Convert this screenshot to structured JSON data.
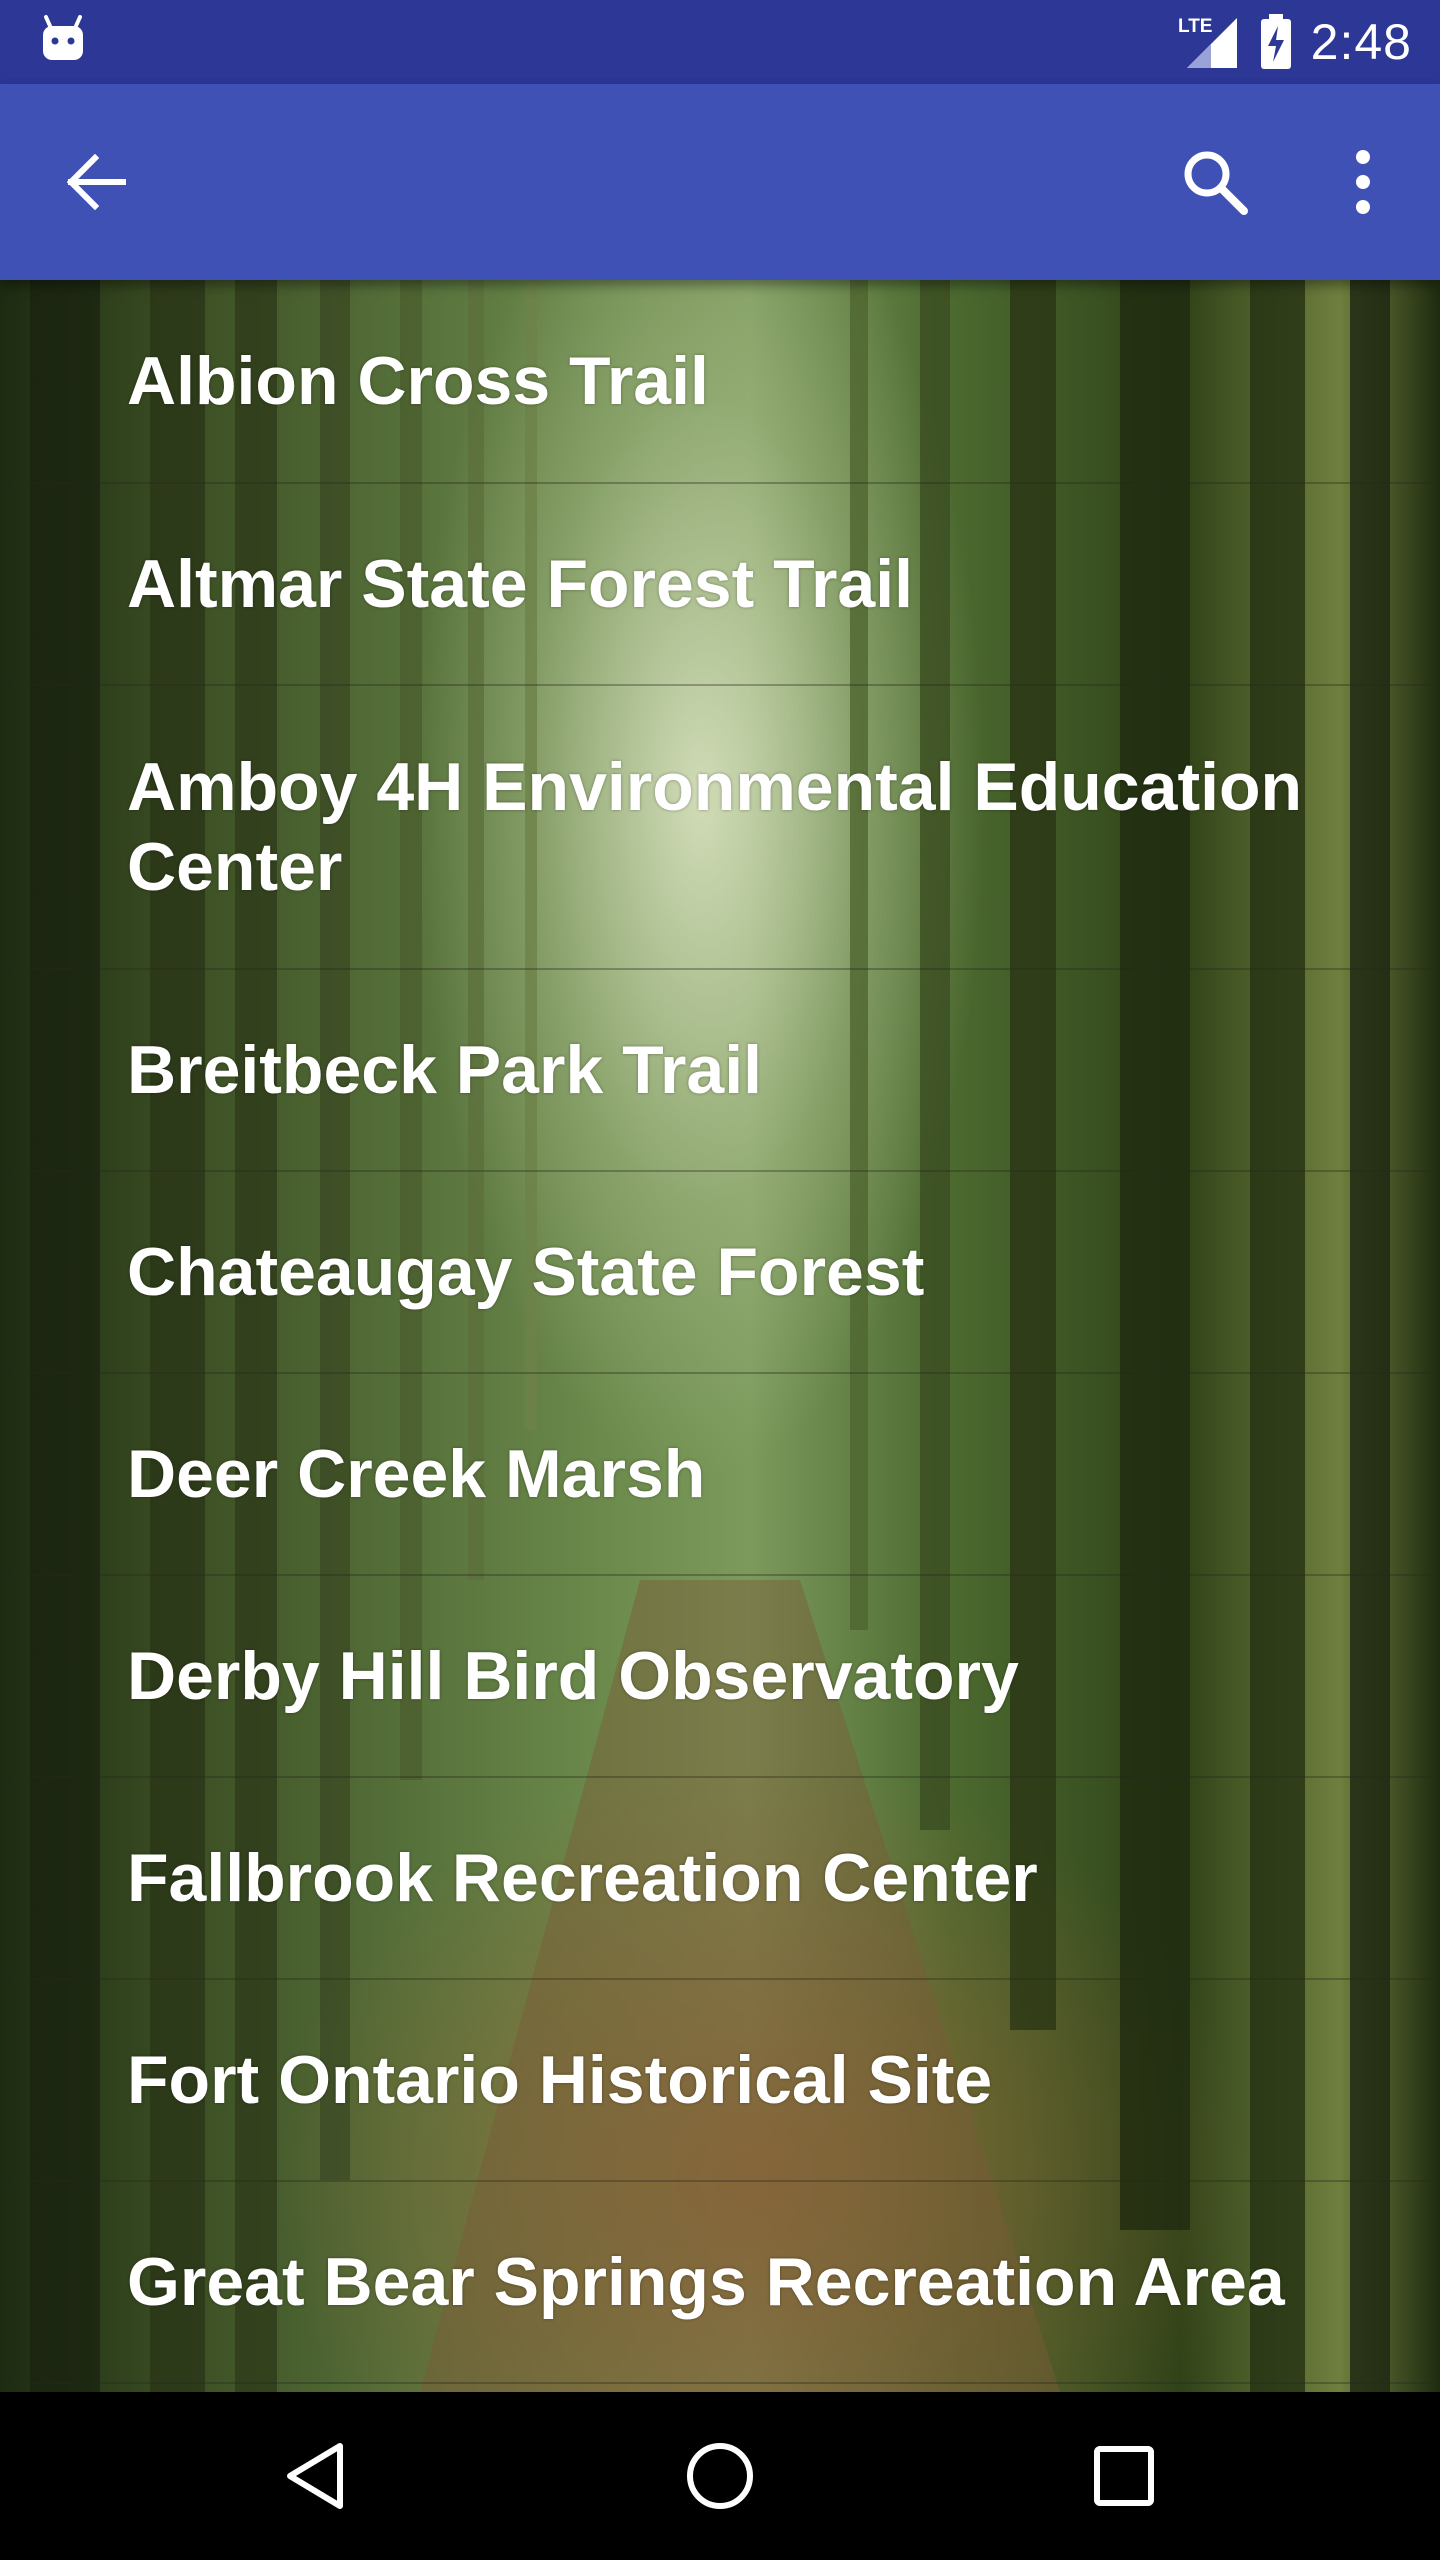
{
  "status_bar": {
    "time": "2:48",
    "network_label": "LTE",
    "left_icon": "android-icon",
    "icons": [
      "lte-signal-icon",
      "battery-charging-icon"
    ]
  },
  "app_bar": {
    "color": "#3f51b5",
    "status_color": "#2c3796",
    "icons": [
      "arrow-back-icon",
      "search-icon",
      "more-vert-icon"
    ]
  },
  "trails": [
    {
      "name": "Albion Cross Trail"
    },
    {
      "name": "Altmar State Forest Trail"
    },
    {
      "name": "Amboy 4H Environmental Education Center"
    },
    {
      "name": "Breitbeck Park Trail"
    },
    {
      "name": "Chateaugay State Forest"
    },
    {
      "name": "Deer Creek Marsh"
    },
    {
      "name": "Derby Hill Bird Observatory"
    },
    {
      "name": "Fallbrook Recreation Center"
    },
    {
      "name": "Fort Ontario Historical Site"
    },
    {
      "name": "Great Bear Springs Recreation Area"
    }
  ],
  "nav_bar": {
    "icons": [
      "nav-back-icon",
      "nav-home-icon",
      "nav-recents-icon"
    ]
  }
}
